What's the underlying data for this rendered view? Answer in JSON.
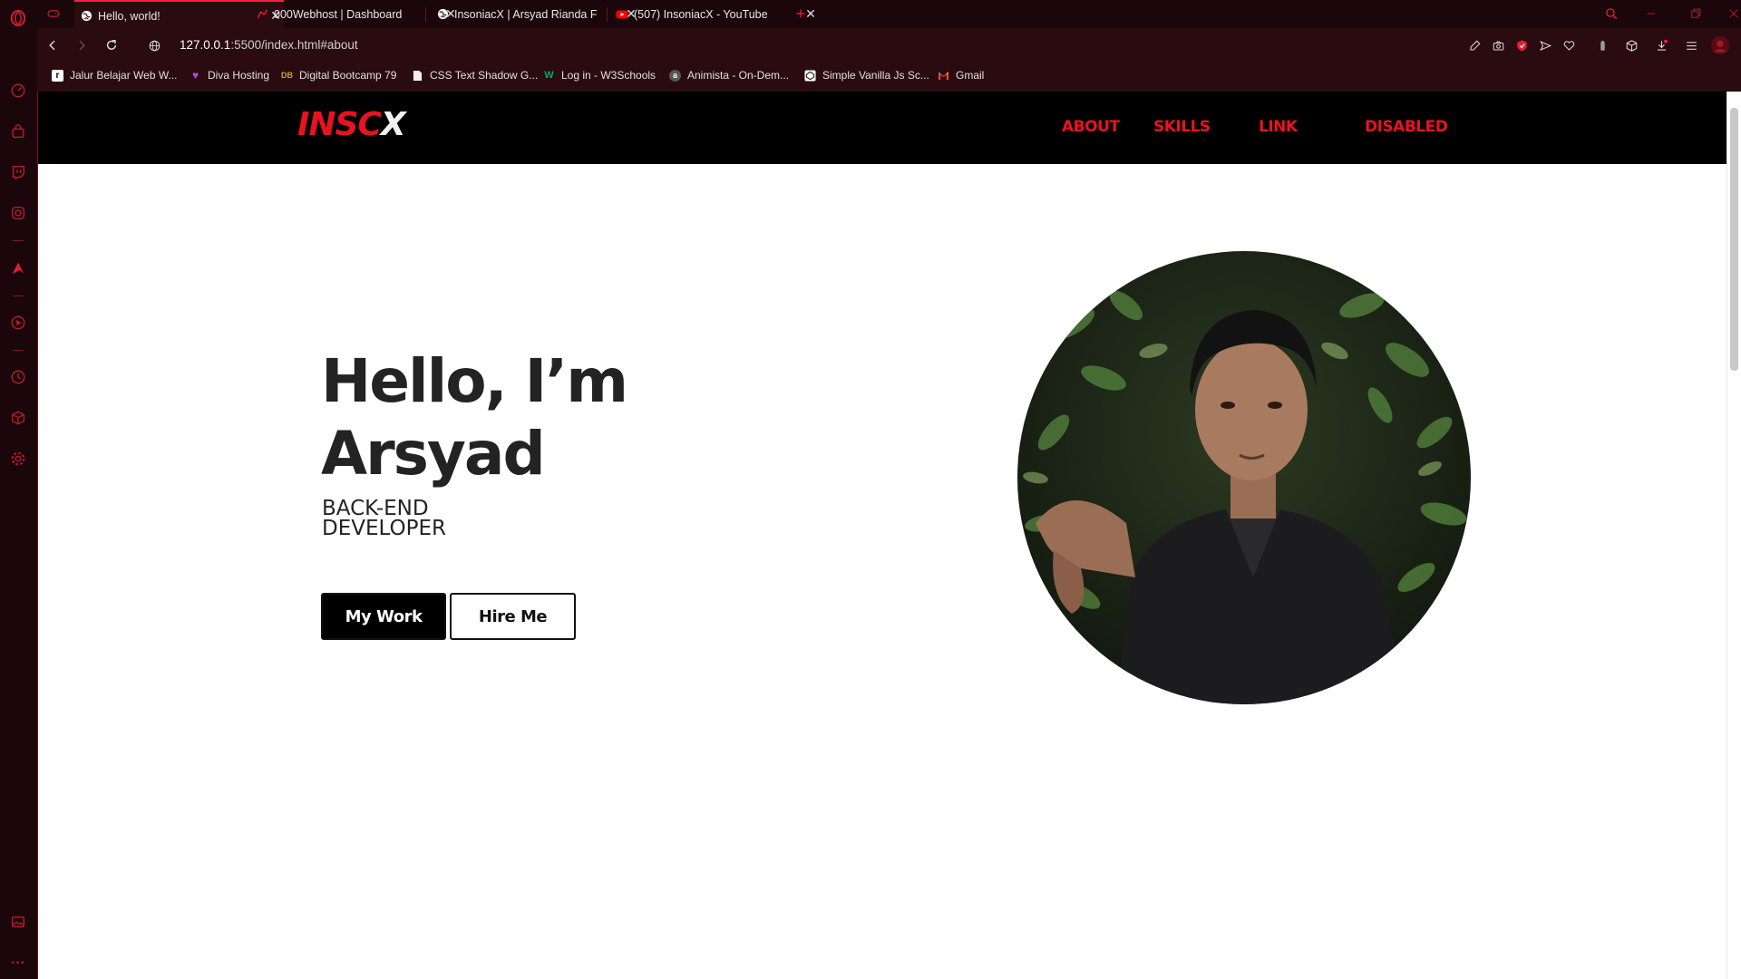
{
  "browser": {
    "tabs": [
      {
        "title": "Hello, world!",
        "active": true,
        "favicon": "globe-icon"
      },
      {
        "title": "000Webhost | Dashboard",
        "active": false,
        "favicon": "webhost-icon"
      },
      {
        "title": "InsoniacX | Arsyad Rianda F",
        "active": false,
        "favicon": "globe-icon"
      },
      {
        "title": "(507) InsoniacX - YouTube",
        "active": false,
        "favicon": "youtube-icon"
      }
    ],
    "new_tab": "+",
    "url": {
      "host": "127.0.0.1",
      "path": ":5500/index.html#about"
    },
    "bookmarks": [
      {
        "label": "Jalur Belajar Web W...",
        "icon": "dicoding-icon"
      },
      {
        "label": "Diva Hosting",
        "icon": "heart-icon"
      },
      {
        "label": "Digital Bootcamp 79",
        "icon": "bootcamp-icon"
      },
      {
        "label": "CSS Text Shadow G...",
        "icon": "page-icon"
      },
      {
        "label": "Log in - W3Schools",
        "icon": "w3schools-icon"
      },
      {
        "label": "Animista - On-Dem...",
        "icon": "animista-icon"
      },
      {
        "label": "Simple Vanilla Js Sc...",
        "icon": "codepen-icon"
      },
      {
        "label": "Gmail",
        "icon": "gmail-icon"
      }
    ],
    "accent": "#ff1f3d"
  },
  "site": {
    "logo_red": "INSC",
    "logo_white": "X",
    "nav": [
      "ABOUT",
      "SKILLS",
      "LINK",
      "DISABLED"
    ],
    "greeting_line1": "Hello, I’m",
    "greeting_line2": "Arsyad",
    "role_line1": "BACK-END",
    "role_line2": "DEVELOPER",
    "btn_work": "My Work",
    "btn_hire": "Hire Me",
    "brand_red": "#e8131f"
  }
}
